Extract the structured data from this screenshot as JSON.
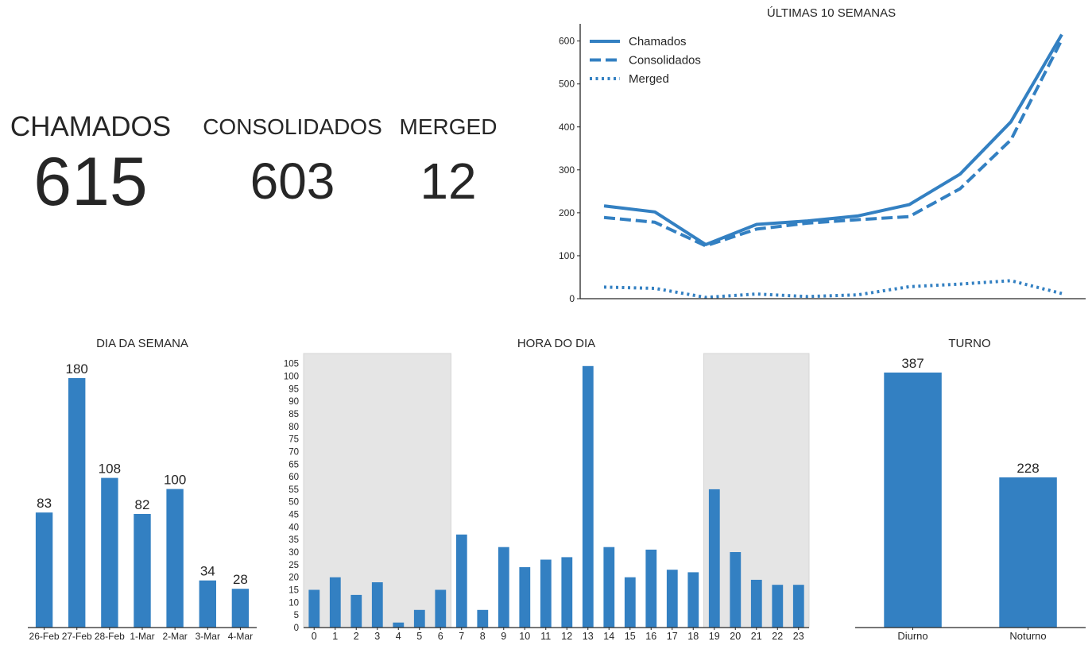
{
  "kpis": [
    {
      "label": "CHAMADOS",
      "value": "615"
    },
    {
      "label": "CONSOLIDADOS",
      "value": "603"
    },
    {
      "label": "MERGED",
      "value": "12"
    }
  ],
  "colors": {
    "bar": "#3380c2",
    "shade": "#e5e5e5",
    "axis": "#262626"
  },
  "chart_data": [
    {
      "type": "line",
      "title": "ÚLTIMAS 10 SEMANAS",
      "x": [
        1,
        2,
        3,
        4,
        5,
        6,
        7,
        8,
        9,
        10
      ],
      "series": [
        {
          "name": "Chamados",
          "style": "solid",
          "values": [
            216,
            202,
            126,
            173,
            181,
            193,
            219,
            290,
            412,
            615
          ]
        },
        {
          "name": "Consolidados",
          "style": "dashed",
          "values": [
            189,
            178,
            123,
            162,
            176,
            184,
            191,
            256,
            370,
            603
          ]
        },
        {
          "name": "Merged",
          "style": "dotted",
          "values": [
            27,
            24,
            3,
            11,
            5,
            9,
            28,
            34,
            42,
            12
          ]
        }
      ],
      "ylim": [
        0,
        640
      ],
      "yticks": [
        "0",
        "100",
        "200",
        "300",
        "400",
        "500",
        "600"
      ],
      "legend": "top-left",
      "grid": false
    },
    {
      "type": "bar",
      "title": "DIA DA SEMANA",
      "categories": [
        "26-Feb",
        "27-Feb",
        "28-Feb",
        "1-Mar",
        "2-Mar",
        "3-Mar",
        "4-Mar"
      ],
      "values": [
        83,
        180,
        108,
        82,
        100,
        34,
        28
      ],
      "ylim": [
        0,
        180
      ]
    },
    {
      "type": "bar",
      "title": "HORA DO DIA",
      "categories": [
        "0",
        "1",
        "2",
        "3",
        "4",
        "5",
        "6",
        "7",
        "8",
        "9",
        "10",
        "11",
        "12",
        "13",
        "14",
        "15",
        "16",
        "17",
        "18",
        "19",
        "20",
        "21",
        "22",
        "23"
      ],
      "values": [
        15,
        20,
        13,
        18,
        2,
        7,
        15,
        37,
        7,
        32,
        24,
        27,
        28,
        104,
        32,
        20,
        31,
        23,
        22,
        55,
        30,
        19,
        17,
        17
      ],
      "yticks": [
        "0",
        "5",
        "10",
        "15",
        "20",
        "25",
        "30",
        "35",
        "40",
        "45",
        "50",
        "55",
        "60",
        "65",
        "70",
        "75",
        "80",
        "85",
        "90",
        "95",
        "100",
        "105"
      ],
      "ylim": [
        0,
        109
      ],
      "shaded_ranges": [
        [
          -0.5,
          6.5
        ],
        [
          18.5,
          23.5
        ]
      ]
    },
    {
      "type": "bar",
      "title": "TURNO",
      "categories": [
        "Diurno",
        "Noturno"
      ],
      "values": [
        387,
        228
      ],
      "ylim": [
        0,
        387
      ]
    }
  ]
}
